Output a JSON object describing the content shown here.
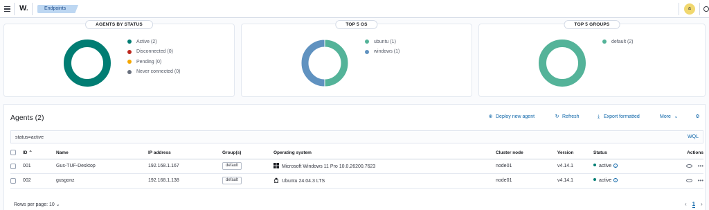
{
  "header": {
    "logo": "W",
    "logo_sub": "•",
    "breadcrumb": "Endpoints",
    "avatar_initial": "a"
  },
  "colors": {
    "active": "#017d73",
    "disconnected": "#bd271e",
    "pending": "#f5a700",
    "never_connected": "#69707d",
    "ubuntu": "#54b399",
    "windows": "#6092c0",
    "default_group": "#54b399",
    "link": "#0b64a8"
  },
  "cards": {
    "status": {
      "title": "AGENTS BY STATUS",
      "legend": [
        "Active (2)",
        "Disconnected (0)",
        "Pending (0)",
        "Never connected (0)"
      ],
      "chart_data": {
        "type": "pie",
        "categories": [
          "Active",
          "Disconnected",
          "Pending",
          "Never connected"
        ],
        "values": [
          2,
          0,
          0,
          0
        ]
      }
    },
    "os": {
      "title": "TOP 5 OS",
      "legend": [
        "ubuntu (1)",
        "windows (1)"
      ],
      "chart_data": {
        "type": "pie",
        "categories": [
          "ubuntu",
          "windows"
        ],
        "values": [
          1,
          1
        ]
      }
    },
    "groups": {
      "title": "TOP 5 GROUPS",
      "legend": [
        "default (2)"
      ],
      "chart_data": {
        "type": "pie",
        "categories": [
          "default"
        ],
        "values": [
          2
        ]
      }
    }
  },
  "agents": {
    "title": "Agents (2)",
    "actions": {
      "deploy": "Deploy new agent",
      "refresh": "Refresh",
      "export": "Export formatted",
      "more": "More"
    },
    "search": {
      "value": "status=active",
      "lang": "WQL"
    },
    "columns": [
      "ID",
      "Name",
      "IP address",
      "Group(s)",
      "Operating system",
      "Cluster node",
      "Version",
      "Status",
      "Actions"
    ],
    "rows": [
      {
        "id": "001",
        "name": "Gus-TUF-Desktop",
        "ip": "192.168.1.167",
        "group": "default",
        "os": "Microsoft Windows 11 Pro 10.0.26200.7623",
        "os_icon": "windows-icon",
        "node": "node01",
        "version": "v4.14.1",
        "status": "active"
      },
      {
        "id": "002",
        "name": "gusgonz",
        "ip": "192.168.1.138",
        "group": "default",
        "os": "Ubuntu 24.04.3 LTS",
        "os_icon": "linux-icon",
        "node": "node01",
        "version": "v4.14.1",
        "status": "active"
      }
    ],
    "rows_per_page": "Rows per page: 10",
    "page": "1"
  }
}
